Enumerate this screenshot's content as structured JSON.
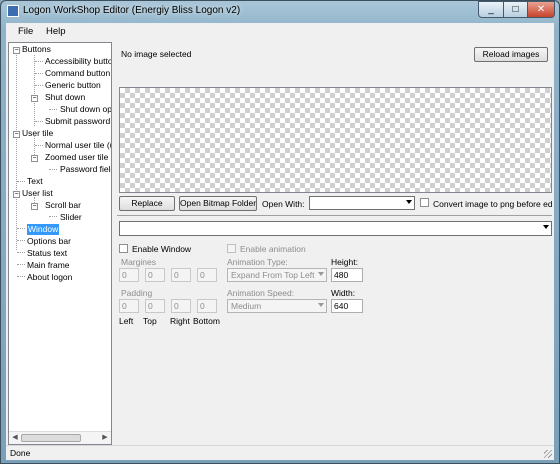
{
  "window": {
    "title": "Logon WorkShop Editor (Energiy Bliss Logon v2)",
    "minimize_glyph": "_",
    "maximize_glyph": "□",
    "close_glyph": "✕"
  },
  "menu": {
    "items": [
      "File",
      "Help"
    ]
  },
  "tree": {
    "expander_collapse": "−",
    "nodes": {
      "buttons": "Buttons",
      "accessibility_button": "Accessibility button",
      "command_button": "Command button",
      "generic_button": "Generic button",
      "shut_down": "Shut down",
      "shut_down_options": "Shut down optio",
      "submit_password": "Submit password bu",
      "user_tile": "User tile",
      "normal_user_tile": "Normal user tile (use",
      "zoomed_user_tile": "Zoomed user tile (pa",
      "password_field": "Password field",
      "text": "Text",
      "user_list": "User list",
      "scroll_bar": "Scroll bar",
      "slider": "Slider",
      "window": "Window",
      "options_bar": "Options bar",
      "status_text": "Status text",
      "main_frame": "Main frame",
      "about_logon": "About logon"
    },
    "scroll_left_glyph": "◀",
    "scroll_right_glyph": "▶"
  },
  "image_panel": {
    "status": "No image selected",
    "reload_label": "Reload images",
    "replace_label": "Replace",
    "open_bitmap_label": "Open Bitmap Folder",
    "open_with_label": "Open With:",
    "open_with_value": "",
    "convert_label": "Convert image to png before editing",
    "convert_checked": false,
    "element_select_value": ""
  },
  "settings": {
    "enable_window_label": "Enable Window",
    "enable_window_checked": false,
    "margines_label": "Margines",
    "margines": [
      "0",
      "0",
      "0",
      "0"
    ],
    "padding_label": "Padding",
    "padding": [
      "0",
      "0",
      "0",
      "0"
    ],
    "side_labels": [
      "Left",
      "Top",
      "Right",
      "Bottom"
    ],
    "enable_animation_label": "Enable animation",
    "animation_type_label": "Animation Type:",
    "animation_type_value": "Expand From Top Left",
    "animation_speed_label": "Animation Speed:",
    "animation_speed_value": "Medium",
    "height_label": "Height:",
    "height_value": "480",
    "width_label": "Width:",
    "width_value": "640"
  },
  "statusbar": {
    "text": "Done"
  }
}
